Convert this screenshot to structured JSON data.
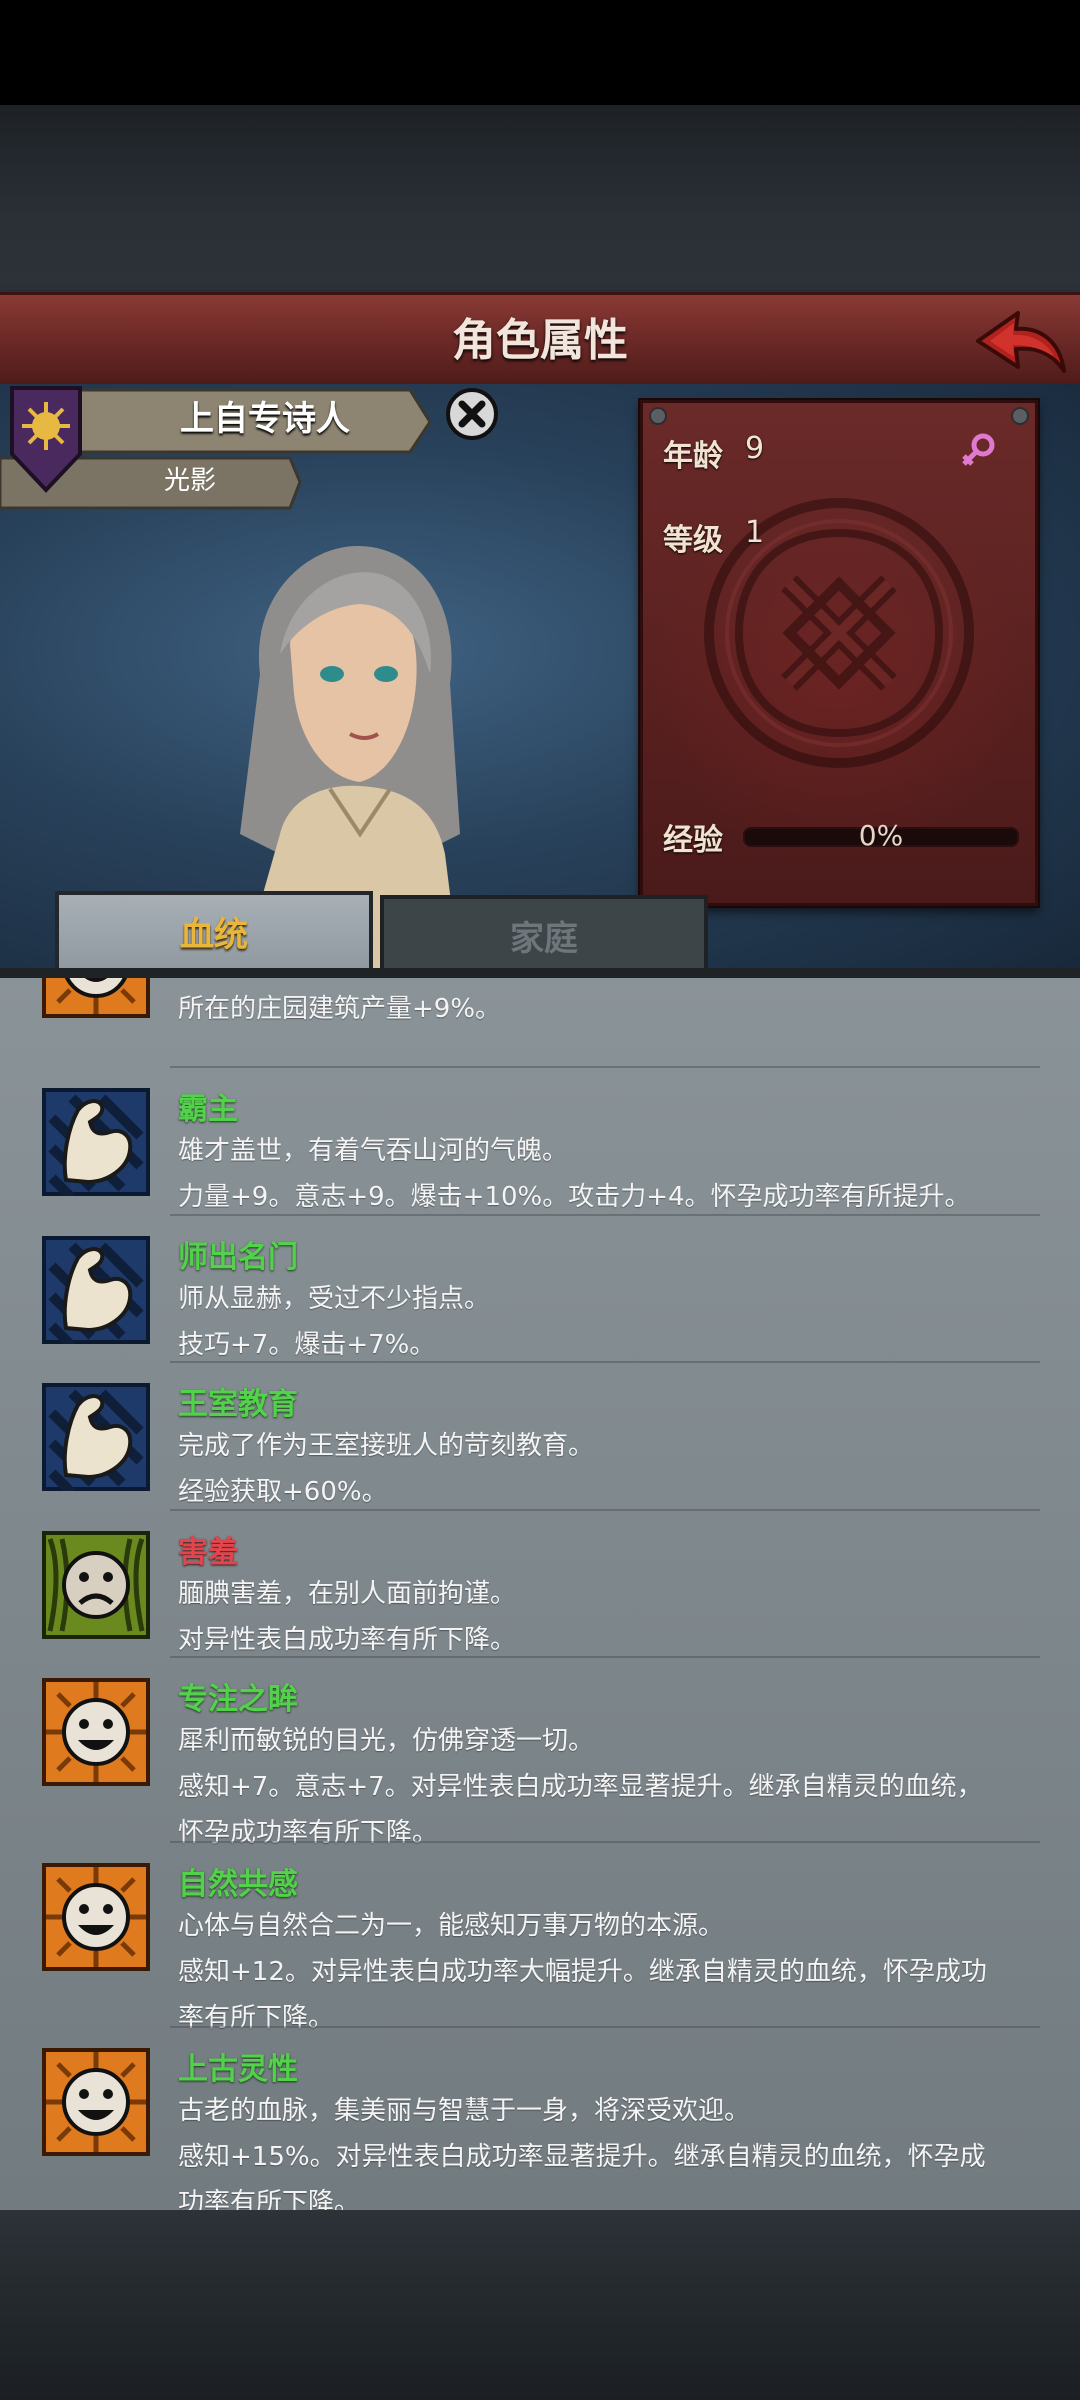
{
  "header": {
    "title": "角色属性"
  },
  "character": {
    "name": "上自专诗人",
    "subtitle": "光影"
  },
  "stats": {
    "age_label": "年龄",
    "age_value": "9",
    "level_label": "等级",
    "level_value": "1",
    "exp_label": "经验",
    "exp_value": "0%",
    "exp_fraction": 0
  },
  "tabs": {
    "active": "血统",
    "inactive": "家庭"
  },
  "traits": [
    {
      "name": "",
      "lines": [
        "所在的庄园建筑产量+9%。"
      ],
      "icon": "sun-face-icon",
      "color": "green"
    },
    {
      "name": "霸主",
      "lines": [
        "雄才盖世，有着气吞山河的气魄。",
        "力量+9。意志+9。爆击+10%。攻击力+4。怀孕成功率有所提升。"
      ],
      "icon": "muscle-arm-icon",
      "color": "green"
    },
    {
      "name": "师出名门",
      "lines": [
        "师从显赫，受过不少指点。",
        "技巧+7。爆击+7%。"
      ],
      "icon": "muscle-arm-icon",
      "color": "green"
    },
    {
      "name": "王室教育",
      "lines": [
        "完成了作为王室接班人的苛刻教育。",
        "经验获取+60%。"
      ],
      "icon": "muscle-arm-icon",
      "color": "green"
    },
    {
      "name": "害羞",
      "lines": [
        "腼腆害羞，在别人面前拘谨。",
        "对异性表白成功率有所下降。"
      ],
      "icon": "sad-face-icon",
      "color": "red"
    },
    {
      "name": "专注之眸",
      "lines": [
        "犀利而敏锐的目光，仿佛穿透一切。",
        "感知+7。意志+7。对异性表白成功率显著提升。继承自精灵的血统，",
        "怀孕成功率有所下降。"
      ],
      "icon": "happy-face-icon",
      "color": "green"
    },
    {
      "name": "自然共感",
      "lines": [
        "心体与自然合二为一，能感知万事万物的本源。",
        "感知+12。对异性表白成功率大幅提升。继承自精灵的血统，怀孕成功",
        "率有所下降。"
      ],
      "icon": "happy-face-icon",
      "color": "green"
    },
    {
      "name": "上古灵性",
      "lines": [
        "古老的血脉，集美丽与智慧于一身，将深受欢迎。",
        "感知+15%。对异性表白成功率显著提升。继承自精灵的血统，怀孕成",
        "功率有所下降。"
      ],
      "icon": "happy-face-icon",
      "color": "green"
    }
  ],
  "colors": {
    "accent_gold": "#e9b53a",
    "positive": "#52d24a",
    "negative": "#e1454d",
    "header_red": "#6e2a27"
  }
}
